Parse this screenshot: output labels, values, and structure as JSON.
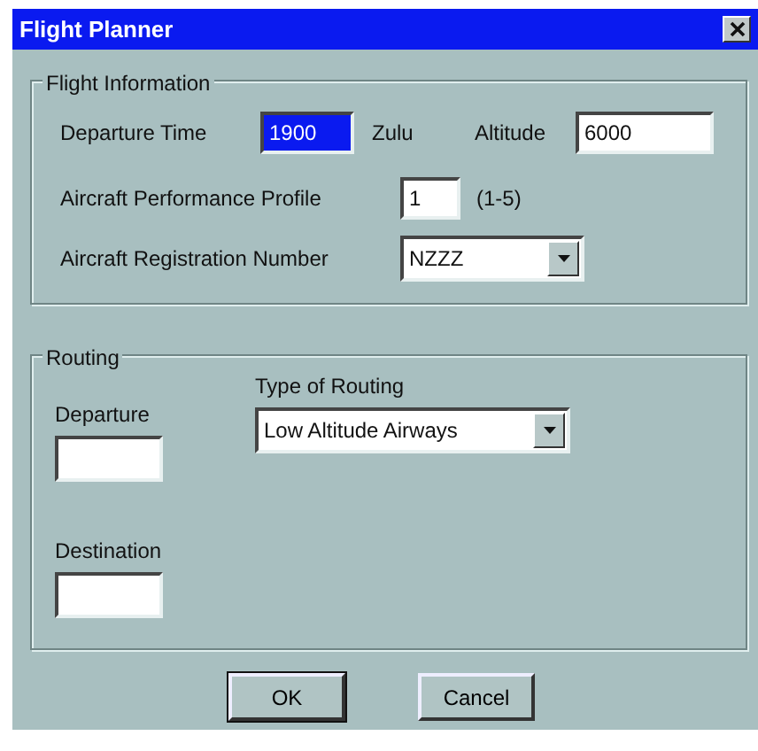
{
  "window": {
    "title": "Flight Planner"
  },
  "flight_information": {
    "title": "Flight Information",
    "departure_time": {
      "label": "Departure Time",
      "value": "1900",
      "text_selected": true,
      "unit": "Zulu"
    },
    "altitude": {
      "label": "Altitude",
      "value": "6000",
      "text_selected": false
    },
    "performance_profile": {
      "label": "Aircraft Performance Profile",
      "value": "1",
      "text_selected": false,
      "hint": "(1-5)"
    },
    "registration": {
      "label": "Aircraft Registration Number",
      "value": "NZZZ"
    }
  },
  "routing": {
    "title": "Routing",
    "departure": {
      "label": "Departure"
    },
    "destination": {
      "label": "Destination"
    },
    "type_of_routing": {
      "label": "Type of Routing",
      "value": "Low Altitude Airways"
    }
  },
  "buttons": [
    {
      "label": "OK",
      "default": true
    },
    {
      "label": "Cancel",
      "default": false
    }
  ]
}
